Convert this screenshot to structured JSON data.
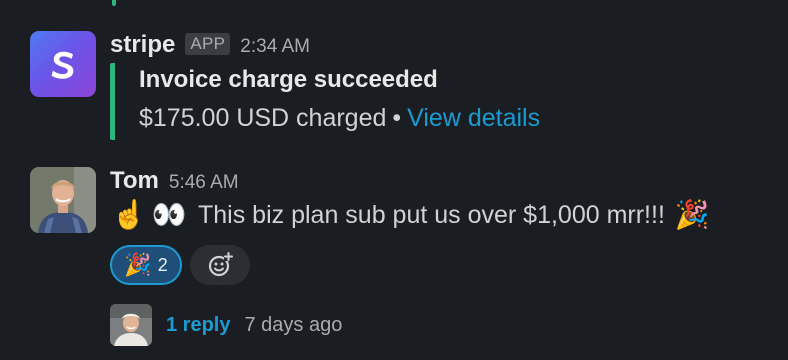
{
  "messages": [
    {
      "sender": "stripe",
      "badge": "APP",
      "time": "2:34 AM",
      "avatar_icon": "stripe-logo",
      "attachment": {
        "title": "Invoice charge succeeded",
        "amount_text": "$175.00 USD charged",
        "separator": "•",
        "link": "View details",
        "accent_color": "#2eb67d"
      }
    },
    {
      "sender": "Tom",
      "time": "5:46 AM",
      "avatar_icon": "user-photo",
      "emoji_prefix": [
        "☝️",
        "👀"
      ],
      "text": "This biz plan sub put us over $1,000 mrr!!!",
      "emoji_suffix": "🎉",
      "reactions": [
        {
          "emoji": "🎉",
          "count": "2",
          "active": true
        }
      ],
      "add_reaction_icon": "add-reaction-icon",
      "thread": {
        "reply_count": "1 reply",
        "last_reply": "7 days ago"
      }
    }
  ],
  "colors": {
    "background": "#1a1d21",
    "link": "#1d9bd1",
    "attachment_bar": "#2eb67d",
    "reaction_active_bg": "#1f4e79"
  }
}
